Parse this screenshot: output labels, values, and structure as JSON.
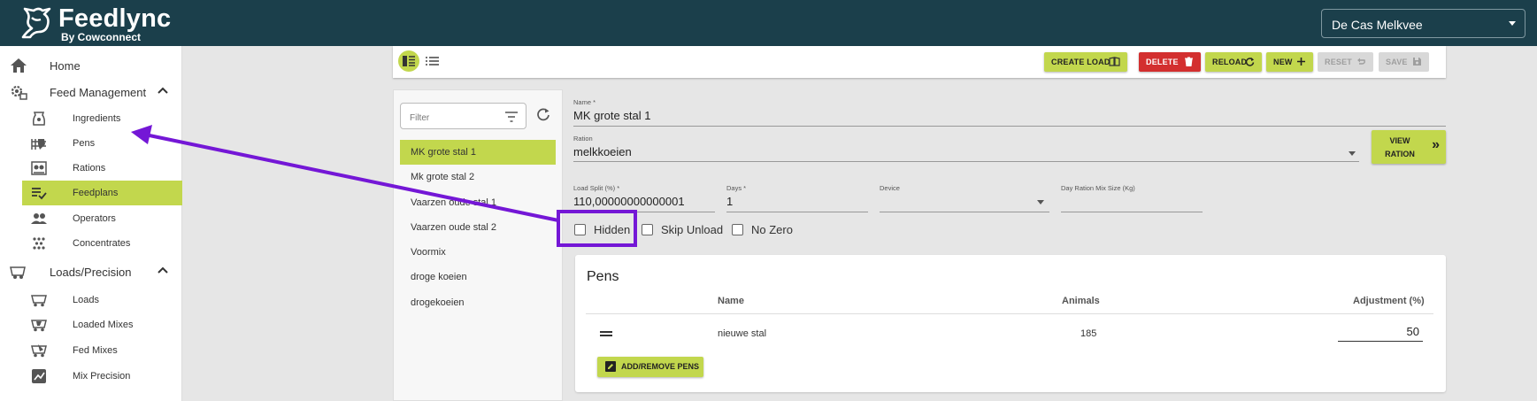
{
  "app": {
    "brand": "Feedlync",
    "brand_sub": "By Cowconnect",
    "farm": "De Cas Melkvee"
  },
  "sidebar": {
    "home": "Home",
    "feed_management": "Feed Management",
    "feed_items": [
      "Ingredients",
      "Pens",
      "Rations",
      "Feedplans",
      "Operators",
      "Concentrates"
    ],
    "loads_precision": "Loads/Precision",
    "loads_items": [
      "Loads",
      "Loaded Mixes",
      "Fed Mixes",
      "Mix Precision"
    ],
    "active_item": "Feedplans"
  },
  "toolbar": {
    "create_load": "CREATE LOAD",
    "delete": "DELETE",
    "reload": "RELOAD",
    "new": "NEW",
    "reset": "RESET",
    "save": "SAVE"
  },
  "list": {
    "filter_placeholder": "Filter",
    "items": [
      "MK grote stal 1",
      "Mk grote stal 2",
      "Vaarzen oude stal 1",
      "Vaarzen oude stal 2",
      "Voormix",
      "droge koeien",
      "drogekoeien"
    ],
    "selected": "MK grote stal 1"
  },
  "form": {
    "name_label": "Name *",
    "name_value": "MK grote stal 1",
    "ration_label": "Ration",
    "ration_value": "melkkoeien",
    "view_ration_line1": "VIEW",
    "view_ration_line2": "RATION",
    "load_split_label": "Load Split (%) *",
    "load_split_value": "110,00000000000001",
    "days_label": "Days *",
    "days_value": "1",
    "device_label": "Device",
    "device_value": "",
    "mix_size_label": "Day Ration Mix Size (Kg)",
    "mix_size_value": "",
    "checkboxes": [
      {
        "label": "Hidden",
        "checked": false
      },
      {
        "label": "Skip Unload",
        "checked": false
      },
      {
        "label": "No Zero",
        "checked": false
      }
    ]
  },
  "pens": {
    "title": "Pens",
    "columns": [
      "Name",
      "Animals",
      "Adjustment (%)"
    ],
    "rows": [
      {
        "name": "nieuwe stal",
        "animals": "185",
        "adjustment": "50"
      }
    ],
    "add_remove": "ADD/REMOVE PENS"
  },
  "colors": {
    "header": "#1b3f4b",
    "accent": "#c2d74d",
    "danger": "#d32f2f",
    "annotation": "#7417d6"
  }
}
